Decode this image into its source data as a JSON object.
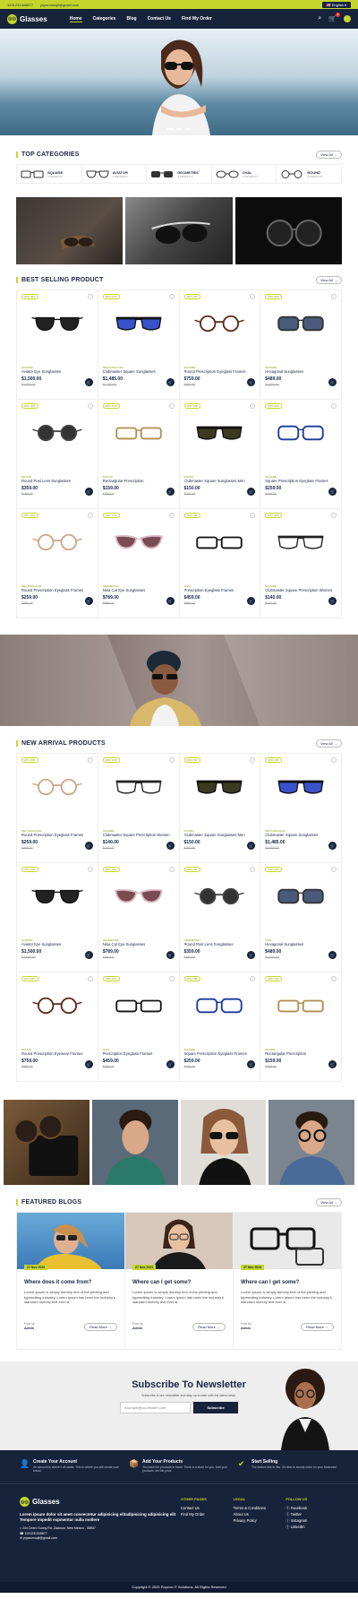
{
  "topbar": {
    "phone": "1231231345877",
    "email": "yopsomsujit@gmail.com",
    "language": "English"
  },
  "nav": {
    "brand": "Glasses",
    "items": [
      {
        "label": "Home"
      },
      {
        "label": "Categories"
      },
      {
        "label": "Blog"
      },
      {
        "label": "Contact Us"
      },
      {
        "label": "Find My Order"
      }
    ],
    "cart_count": "1"
  },
  "categories": {
    "title": "TOP CATEGORIES",
    "view_all": "View All",
    "items": [
      {
        "name": "SQUARE",
        "count": "5 PRODUCT"
      },
      {
        "name": "AVIATOR",
        "count": "4 PRODUCT"
      },
      {
        "name": "GEOMETRIC",
        "count": "3 PRODUCT"
      },
      {
        "name": "OVAL",
        "count": "4 PRODUCT"
      },
      {
        "name": "ROUND",
        "count": "3 PRODUCT"
      }
    ]
  },
  "best_selling": {
    "title": "BEST SELLING PRODUCT",
    "view_all": "View All",
    "products": [
      {
        "off": "20% OFF",
        "cat": "AVIATOR",
        "name": "Aviator Eye Sunglasses",
        "price": "$1,500.00",
        "old": "$2,000.00",
        "lens": "#222",
        "frame": "#111",
        "shape": "aviator"
      },
      {
        "off": "20% OFF",
        "cat": "RECTANGULAR",
        "name": "Clubmaster Square Sunglasses",
        "price": "$1,485.00",
        "old": "$1,750.00",
        "lens": "#3a52c9",
        "frame": "#111",
        "shape": "club"
      },
      {
        "off": "20% OFF",
        "cat": "SQUARE",
        "name": "Round Prescription Eyeglass Frames",
        "price": "$759.00",
        "old": "$980.00",
        "lens": "none",
        "frame": "#5a2a1a",
        "shape": "round"
      },
      {
        "off": "20% OFF",
        "cat": "SQUARE",
        "name": "Hexagonal Sunglasses",
        "price": "$489.00",
        "old": "$1,000.00",
        "lens": "#4a5a7a",
        "frame": "#333",
        "shape": "square"
      },
      {
        "off": "20% OFF",
        "cat": "ROUND",
        "name": "Round Post Lens Sunglasses",
        "price": "$359.00",
        "old": "$489.00",
        "lens": "#333",
        "frame": "#444",
        "shape": "round"
      },
      {
        "off": "20% OFF",
        "cat": "ROUND",
        "name": "Rectangular Prescription",
        "price": "$159.00",
        "old": "$359.00",
        "lens": "none",
        "frame": "#b38b4d",
        "shape": "rect"
      },
      {
        "off": "20% OFF",
        "cat": "ROUND",
        "name": "Clubmaster Square Sunglasses Men",
        "price": "$150.00",
        "old": "$350.00",
        "lens": "#3a3a22",
        "frame": "#111",
        "shape": "club"
      },
      {
        "off": "20% OFF",
        "cat": "SQUARE",
        "name": "Square Prescription Eyeglass Frames",
        "price": "$259.00",
        "old": "$459.00",
        "lens": "none",
        "frame": "#1a3a9a",
        "shape": "square"
      },
      {
        "off": "20% OFF",
        "cat": "RECTANGULAR",
        "name": "Round Prescription Eyeglass Frames",
        "price": "$259.00",
        "old": "$450.00",
        "lens": "none",
        "frame": "#c9a88a",
        "shape": "round"
      },
      {
        "off": "20% OFF",
        "cat": "GEOMETRIC",
        "name": "Nina Cat Eye Sunglasses",
        "price": "$789.00",
        "old": "$989.00",
        "lens": "#7a4a55",
        "frame": "#d9b8c4",
        "shape": "cat"
      },
      {
        "off": "20% OFF",
        "cat": "OVAL",
        "name": "Prescription Eyeglass Frames",
        "price": "$459.00",
        "old": "$689.00",
        "lens": "none",
        "frame": "#111",
        "shape": "rect"
      },
      {
        "off": "20% OFF",
        "cat": "SQUARE",
        "name": "Clubmaster Square Prescription Women",
        "price": "$140.00",
        "old": "$200.00",
        "lens": "none",
        "frame": "#222",
        "shape": "club"
      }
    ]
  },
  "new_arrival": {
    "title": "NEW ARRIVAL PRODUCTS",
    "view_all": "View All",
    "products": [
      {
        "off": "20% OFF",
        "cat": "RECTANGULAR",
        "name": "Round Prescription Eyeglass Frames",
        "price": "$259.00",
        "old": "$360.00",
        "lens": "none",
        "frame": "#c9a88a",
        "shape": "round"
      },
      {
        "off": "20% OFF",
        "cat": "SQUARE",
        "name": "Clubmaster Square Prescription Women",
        "price": "$140.00",
        "old": "$240.00",
        "lens": "none",
        "frame": "#222",
        "shape": "club"
      },
      {
        "off": "20% OFF",
        "cat": "ROUND",
        "name": "Clubmaster Square Sunglasses Men",
        "price": "$150.00",
        "old": "$350.00",
        "lens": "#3a3a22",
        "frame": "#111",
        "shape": "club"
      },
      {
        "off": "20% OFF",
        "cat": "RECTANGULAR",
        "name": "Clubmaster Square Sunglasses",
        "price": "$1,485.00",
        "old": "$1,650.00",
        "lens": "#3a52c9",
        "frame": "#111",
        "shape": "club"
      },
      {
        "off": "20% OFF",
        "cat": "AVIATOR",
        "name": "Aviator Eye Sunglasses",
        "price": "$1,500.00",
        "old": "$2,000.00",
        "lens": "#222",
        "frame": "#111",
        "shape": "aviator"
      },
      {
        "off": "20% OFF",
        "cat": "GEOMETRIC",
        "name": "Nina Cat Eye Sunglasses",
        "price": "$789.00",
        "old": "$989.00",
        "lens": "#7a4a55",
        "frame": "#d9b8c4",
        "shape": "cat"
      },
      {
        "off": "20% OFF",
        "cat": "GEOMETRIC",
        "name": "Round Post Lens Sunglasses",
        "price": "$359.00",
        "old": "$489.00",
        "lens": "#333",
        "frame": "#444",
        "shape": "round"
      },
      {
        "off": "20% OFF",
        "cat": "OVAL",
        "name": "Hexagonal Sunglasses",
        "price": "$489.00",
        "old": "$1,000.00",
        "lens": "#4a5a7a",
        "frame": "#333",
        "shape": "square"
      },
      {
        "off": "20% OFF",
        "cat": "ROUND",
        "name": "Round Prescription Eyewear Frames",
        "price": "$759.00",
        "old": "$880.00",
        "lens": "none",
        "frame": "#5a2a1a",
        "shape": "round"
      },
      {
        "off": "20% OFF",
        "cat": "OVAL",
        "name": "Prescription Eyeglass Frames",
        "price": "$459.00",
        "old": "$689.00",
        "lens": "none",
        "frame": "#111",
        "shape": "rect"
      },
      {
        "off": "20% OFF",
        "cat": "SQUARE",
        "name": "Square Prescription Eyeglass Frames",
        "price": "$259.00",
        "old": "$459.00",
        "lens": "none",
        "frame": "#1a3a9a",
        "shape": "square"
      },
      {
        "off": "20% OFF",
        "cat": "ROUND",
        "name": "Rectangular Prescription",
        "price": "$159.00",
        "old": "$359.00",
        "lens": "none",
        "frame": "#b38b4d",
        "shape": "rect"
      }
    ]
  },
  "blogs": {
    "title": "FEATURED BLOGS",
    "view_all": "View All",
    "items": [
      {
        "date": "27 Nov 2023",
        "title": "Where does it come from?",
        "body": "Lorem Ipsum is simply dummy text of the printing and typesetting industry. Lorem Ipsum has been the industry's standard dummy text ever si...",
        "by": "Post by",
        "author": "Admin",
        "more": "Read More"
      },
      {
        "date": "27 Nov 2023",
        "title": "Where can I get some?",
        "body": "Lorem Ipsum is simply dummy text of the printing and typesetting industry. Lorem Ipsum has been the industry's standard dummy text ever si...",
        "by": "Post by",
        "author": "Admin",
        "more": "Read More"
      },
      {
        "date": "27 Nov 2023",
        "title": "Where can I get some?",
        "body": "Lorem Ipsum is simply dummy text of the printing and typesetting industry. Lorem Ipsum has been the industry's standard dummy text ever si...",
        "by": "Post by",
        "author": "Admin",
        "more": "Read More"
      }
    ]
  },
  "newsletter": {
    "title": "Subscribe To Newsletter",
    "subtitle": "Subscribe to our newsletter and stay up to date with the latest news.",
    "placeholder": "example@yourmailer.com",
    "button": "Subscribe"
  },
  "footer": {
    "features": [
      {
        "title": "Create Your Account",
        "text": "An account is where it all starts. This is where you will create your brand."
      },
      {
        "title": "Add Your Products",
        "text": "You have the products in hand. There is a store for you. Add your products, set the price."
      },
      {
        "title": "Start Selling",
        "text": "The bottom line is this. It's time to accept order for your business!"
      }
    ],
    "brand": "Glasses",
    "description": "Lorem ipsum dolor sit amet consectetur adipisicing elitadipisicing adipisicing elit Tempore impedit expmentur nulla mollere",
    "address": "244 Cedro Sunny Rd, Zackson, New Mexico - 08537",
    "phone": "1231231345877",
    "email": "yopsomsujit@gmail.com",
    "col_other": {
      "title": "OTHER PAGES",
      "links": [
        "Contact Us",
        "Find My Order"
      ]
    },
    "col_legal": {
      "title": "LEGAL",
      "links": [
        "Terms & Conditions",
        "About Us",
        "Privacy Policy"
      ]
    },
    "col_follow": {
      "title": "FOLLOW US",
      "links": [
        "Facebook",
        "Twitter",
        "Instagram",
        "LinkedIn"
      ]
    },
    "copyright": "Copyright © 2025 Popcon IT Solutions. All Rights Reserved"
  },
  "colors": {
    "accent": "#c5d62b",
    "navy": "#17223b"
  }
}
